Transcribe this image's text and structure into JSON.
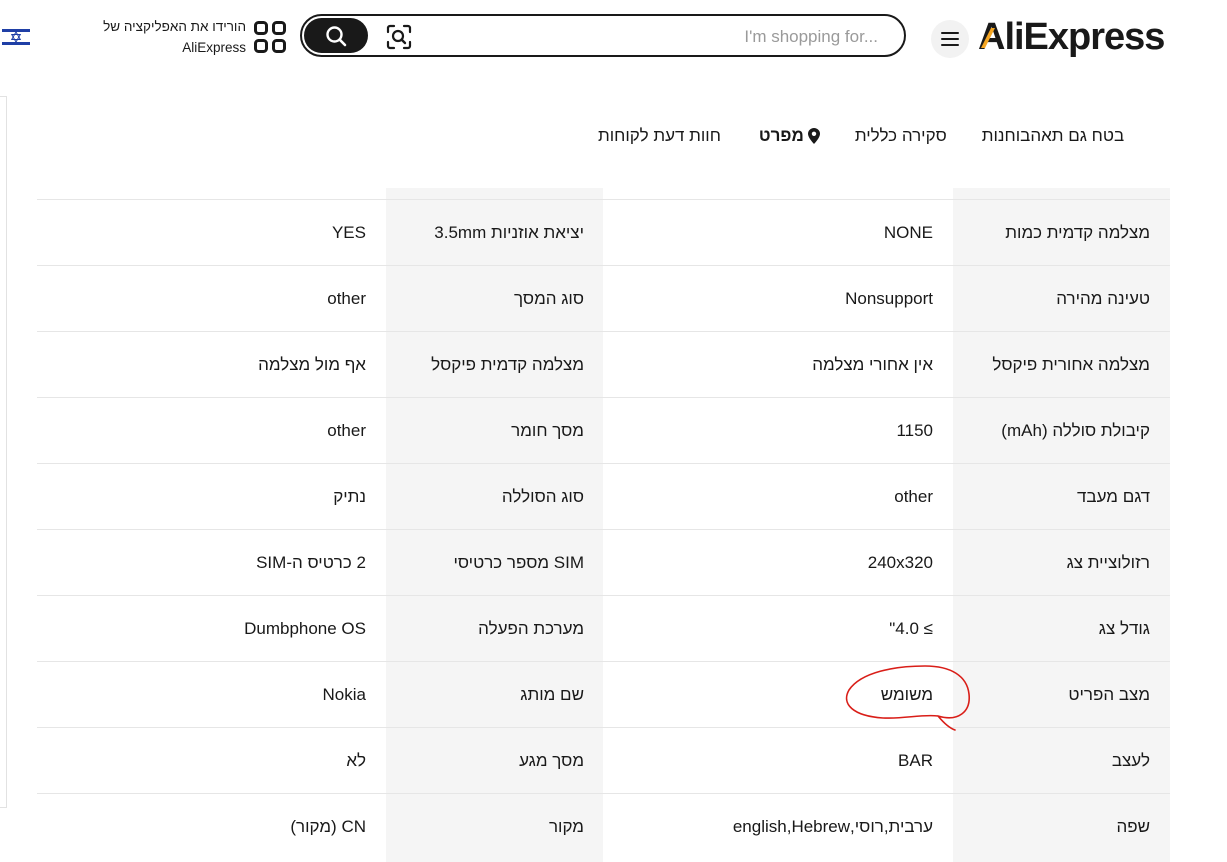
{
  "header": {
    "app_promo_line1": "הורידו את האפליקציה של",
    "app_promo_line2": "AliExpress",
    "search_placeholder": "I'm shopping for...",
    "logo_text": "AliExpress",
    "brand_color": "#191919",
    "accent_color": "#f5a623"
  },
  "tabs": [
    {
      "label": "חוות דעת לקוחות"
    },
    {
      "label": "מפרט",
      "active": true
    },
    {
      "label": "סקירה כללית"
    },
    {
      "label": "חנות"
    },
    {
      "label": "בטח גם תאהבו"
    }
  ],
  "specs": [
    {
      "k1": "מצלמה קדמית כמות",
      "v1": "NONE",
      "k2": "יציאת אוזניות 3.5mm",
      "v2": "YES"
    },
    {
      "k1": "טעינה מהירה",
      "v1": "Nonsupport",
      "k2": "סוג המסך",
      "v2": "other"
    },
    {
      "k1": "מצלמה אחורית פיקסל",
      "v1": "אין אחורי מצלמה",
      "k2": "מצלמה קדמית פיקסל",
      "v2": "אף מול מצלמה"
    },
    {
      "k1": "קיבולת סוללה (mAh)",
      "v1": "1150",
      "k2": "מסך חומר",
      "v2": "other"
    },
    {
      "k1": "דגם מעבד",
      "v1": "other",
      "k2": "סוג הסוללה",
      "v2": "נתיק"
    },
    {
      "k1": "רזולוציית צג",
      "v1": "240x320",
      "k2": "SIM מספר כרטיסי",
      "v2": "2 כרטיס ה-SIM"
    },
    {
      "k1": "גודל צג",
      "v1": "≥ 4.0\"",
      "k2": "מערכת הפעלה",
      "v2": "Dumbphone OS"
    },
    {
      "k1": "מצב הפריט",
      "v1": "משומש",
      "k2": "שם מותג",
      "v2": "Nokia"
    },
    {
      "k1": "לעצב",
      "v1": "BAR",
      "k2": "מסך מגע",
      "v2": "לא"
    },
    {
      "k1": "שפה",
      "v1": "ערבית,רוסי,english,Hebrew",
      "k2": "מקור",
      "v2": "CN (מקור)"
    }
  ]
}
